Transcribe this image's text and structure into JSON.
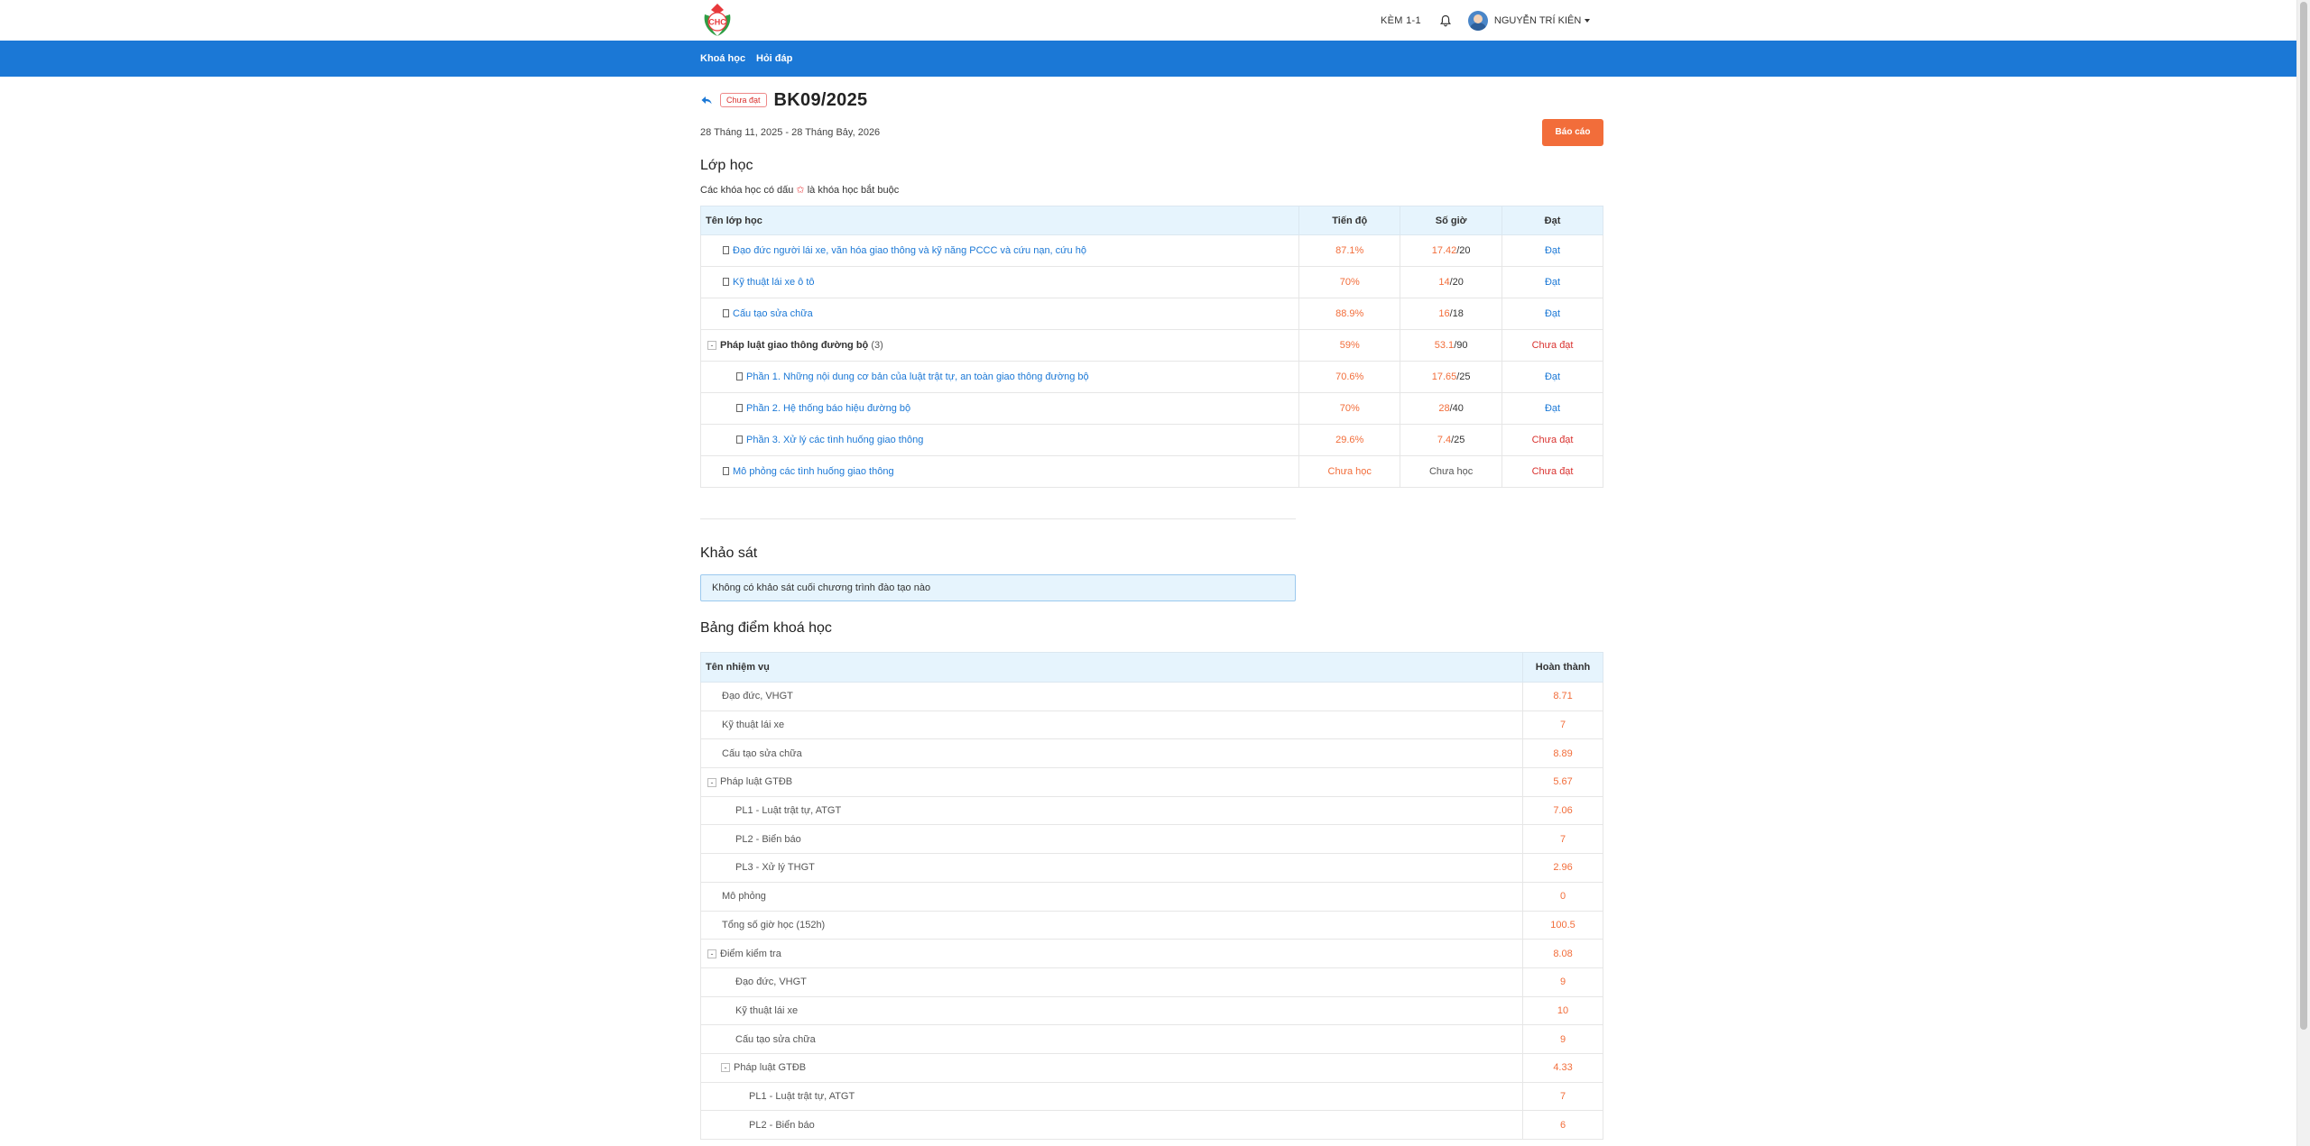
{
  "header": {
    "logo_text": "CHC",
    "link_label": "KÈM 1-1",
    "user_name": "NGUYỄN TRÍ KIÊN"
  },
  "nav": {
    "items": [
      "Khoá học",
      "Hỏi đáp"
    ]
  },
  "course": {
    "status_badge": "Chưa đạt",
    "title": "BK09/2025",
    "dates": "28 Tháng 11, 2025 - 28 Tháng Bảy, 2026",
    "report_button": "Báo cáo"
  },
  "classes": {
    "heading": "Lớp học",
    "note_before": "Các khóa học có dấu",
    "note_star": "✩",
    "note_after": "là khóa học bắt buộc",
    "columns": [
      "Tên lớp học",
      "Tiến độ",
      "Số giờ",
      "Đạt"
    ],
    "rows": [
      {
        "name": "Đạo đức người lái xe, văn hóa giao thông và kỹ năng PCCC và cứu nạn, cứu hộ",
        "progress": "87.1%",
        "hours_done": "17.42",
        "hours_total": "/20",
        "result": "Đạt"
      },
      {
        "name": "Kỹ thuật lái xe ô tô",
        "progress": "70%",
        "hours_done": "14",
        "hours_total": "/20",
        "result": "Đạt"
      },
      {
        "name": "Cấu tạo sửa chữa",
        "progress": "88.9%",
        "hours_done": "16",
        "hours_total": "/18",
        "result": "Đạt"
      },
      {
        "name": "Pháp luật giao thông đường bộ",
        "count": "(3)",
        "progress": "59%",
        "hours_done": "53.1",
        "hours_total": "/90",
        "result": "Chưa đạt"
      },
      {
        "name": "Phần 1. Những nội dung cơ bản của luật trật tự, an toàn giao thông đường bộ",
        "progress": "70.6%",
        "hours_done": "17.65",
        "hours_total": "/25",
        "result": "Đạt"
      },
      {
        "name": "Phần 2. Hệ thống báo hiệu đường bộ",
        "progress": "70%",
        "hours_done": "28",
        "hours_total": "/40",
        "result": "Đạt"
      },
      {
        "name": "Phần 3. Xử lý các tình huống giao thông",
        "progress": "29.6%",
        "hours_done": "7.4",
        "hours_total": "/25",
        "result": "Chưa đạt"
      },
      {
        "name": "Mô phỏng các tình huống giao thông",
        "progress": "Chưa học",
        "hours_text": "Chưa học",
        "result": "Chưa đạt"
      }
    ]
  },
  "survey": {
    "heading": "Khảo sát",
    "message": "Không có khảo sát cuối chương trình đào tạo nào"
  },
  "scores": {
    "heading": "Bảng điểm khoá học",
    "columns": [
      "Tên nhiệm vụ",
      "Hoàn thành"
    ],
    "rows": [
      {
        "name": "Đạo đức, VHGT",
        "value": "8.71"
      },
      {
        "name": "Kỹ thuật lái xe",
        "value": "7"
      },
      {
        "name": "Cấu tạo sửa chữa",
        "value": "8.89"
      },
      {
        "name": "Pháp luật GTĐB",
        "value": "5.67"
      },
      {
        "name": "PL1 - Luật trật tự, ATGT",
        "value": "7.06"
      },
      {
        "name": "PL2 - Biển báo",
        "value": "7"
      },
      {
        "name": "PL3 - Xử lý THGT",
        "value": "2.96"
      },
      {
        "name": "Mô phỏng",
        "value": "0"
      },
      {
        "name": "Tổng số giờ học (152h)",
        "value": "100.5"
      },
      {
        "name": "Điểm kiểm tra",
        "value": "8.08"
      },
      {
        "name": "Đạo đức, VHGT",
        "value": "9"
      },
      {
        "name": "Kỹ thuật lái xe",
        "value": "10"
      },
      {
        "name": "Cấu tạo sửa chữa",
        "value": "9"
      },
      {
        "name": "Pháp luật GTĐB",
        "value": "4.33"
      },
      {
        "name": "PL1 - Luật trật tự, ATGT",
        "value": "7"
      },
      {
        "name": "PL2 - Biển báo",
        "value": "6"
      }
    ]
  },
  "colors": {
    "primary": "#1b78d6",
    "accent": "#f26d3a",
    "danger": "#d9322f",
    "table_header": "#e6f4fd"
  }
}
